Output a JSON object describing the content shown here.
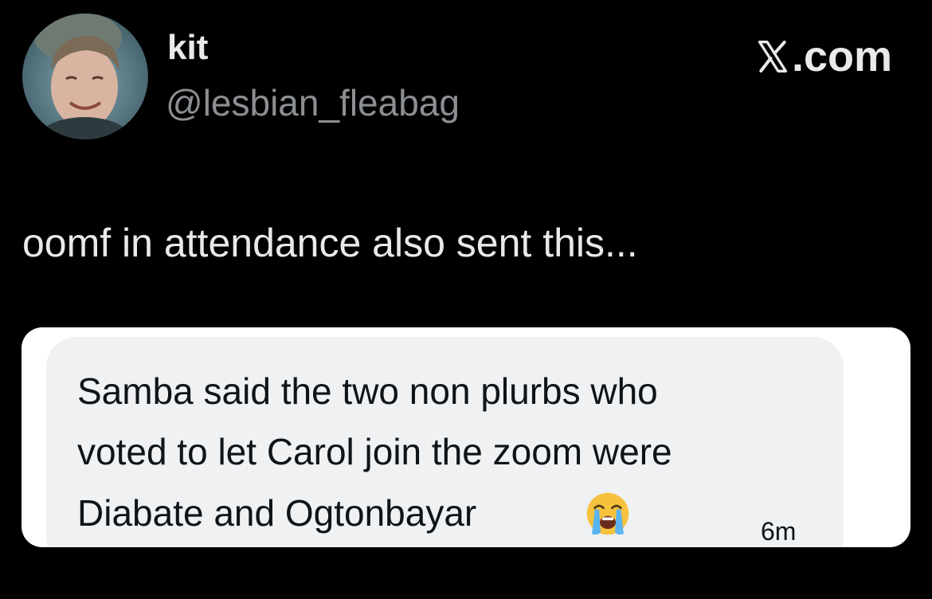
{
  "author": {
    "display_name": "kit",
    "handle": "@lesbian_fleabag",
    "avatar_icon": "profile-photo"
  },
  "brand": {
    "label": ".com",
    "icon": "x-logo-icon"
  },
  "tweet": {
    "text": "oomf in attendance also sent this..."
  },
  "message": {
    "line1": "Samba said the two non plurbs who",
    "line2": "voted to let Carol join the zoom were",
    "line3": "Diabate and Ogtonbayar",
    "emoji": "loudly-crying-face-icon",
    "time": "6m"
  },
  "colors": {
    "background": "#000000",
    "primary_text": "#e7e9ea",
    "secondary_text": "#8b8f93",
    "card_background": "#ffffff",
    "bubble_background": "#eff1f3"
  }
}
